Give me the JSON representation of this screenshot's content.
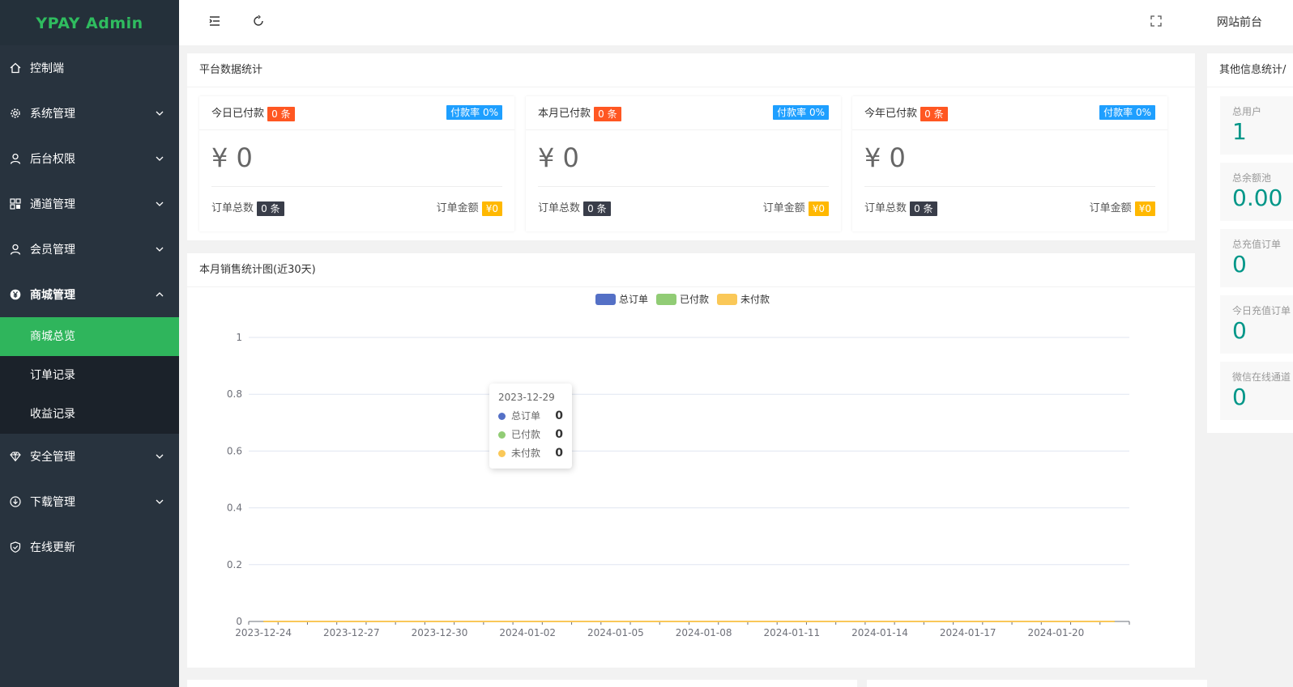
{
  "app": {
    "logo": "YPAY Admin"
  },
  "sidebar": {
    "items": [
      {
        "label": "控制端",
        "icon": "home-icon"
      },
      {
        "label": "系统管理",
        "icon": "gear-icon"
      },
      {
        "label": "后台权限",
        "icon": "user-icon"
      },
      {
        "label": "通道管理",
        "icon": "apps-icon"
      },
      {
        "label": "会员管理",
        "icon": "user-icon"
      },
      {
        "label": "商城管理",
        "icon": "rmb-icon"
      },
      {
        "label": "安全管理",
        "icon": "diamond-icon"
      },
      {
        "label": "下载管理",
        "icon": "download-icon"
      },
      {
        "label": "在线更新",
        "icon": "shield-icon"
      }
    ],
    "sub_items": [
      {
        "label": "商城总览"
      },
      {
        "label": "订单记录"
      },
      {
        "label": "收益记录"
      }
    ]
  },
  "header": {
    "site_link": "网站前台"
  },
  "platform": {
    "title": "平台数据统计",
    "cards": [
      {
        "head": "今日已付款",
        "count_badge": "0 条",
        "rate_badge": "付款率 0%",
        "amount": "¥ 0",
        "orders_label": "订单总数",
        "orders_badge": "0 条",
        "amount_label": "订单金额",
        "amount_badge": "¥0"
      },
      {
        "head": "本月已付款",
        "count_badge": "0 条",
        "rate_badge": "付款率 0%",
        "amount": "¥ 0",
        "orders_label": "订单总数",
        "orders_badge": "0 条",
        "amount_label": "订单金额",
        "amount_badge": "¥0"
      },
      {
        "head": "今年已付款",
        "count_badge": "0 条",
        "rate_badge": "付款率 0%",
        "amount": "¥ 0",
        "orders_label": "订单总数",
        "orders_badge": "0 条",
        "amount_label": "订单金额",
        "amount_badge": "¥0"
      }
    ]
  },
  "other": {
    "title": "其他信息统计/",
    "blocks": [
      {
        "label": "总用户",
        "value": "1"
      },
      {
        "label": "总余额池",
        "value": "0.00"
      },
      {
        "label": "总充值订单",
        "value": "0"
      },
      {
        "label": "今日充值订单",
        "value": "0"
      },
      {
        "label": "微信在线通道",
        "value": "0"
      }
    ]
  },
  "chart_card": {
    "title": "本月销售统计图(近30天)"
  },
  "chart_data": {
    "type": "line",
    "title": "本月销售统计图(近30天)",
    "x": [
      "2023-12-24",
      "2023-12-25",
      "2023-12-26",
      "2023-12-27",
      "2023-12-28",
      "2023-12-29",
      "2023-12-30",
      "2023-12-31",
      "2024-01-01",
      "2024-01-02",
      "2024-01-03",
      "2024-01-04",
      "2024-01-05",
      "2024-01-06",
      "2024-01-07",
      "2024-01-08",
      "2024-01-09",
      "2024-01-10",
      "2024-01-11",
      "2024-01-12",
      "2024-01-13",
      "2024-01-14",
      "2024-01-15",
      "2024-01-16",
      "2024-01-17",
      "2024-01-18",
      "2024-01-19",
      "2024-01-20",
      "2024-01-21",
      "2024-01-22"
    ],
    "x_tick_labels": [
      "2023-12-24",
      "2023-12-27",
      "2023-12-30",
      "2024-01-02",
      "2024-01-05",
      "2024-01-08",
      "2024-01-11",
      "2024-01-14",
      "2024-01-17",
      "2024-01-20"
    ],
    "series": [
      {
        "name": "总订单",
        "color": "#5470c6",
        "values": [
          0,
          0,
          0,
          0,
          0,
          0,
          0,
          0,
          0,
          0,
          0,
          0,
          0,
          0,
          0,
          0,
          0,
          0,
          0,
          0,
          0,
          0,
          0,
          0,
          0,
          0,
          0,
          0,
          0,
          0
        ]
      },
      {
        "name": "已付款",
        "color": "#91cc75",
        "values": [
          0,
          0,
          0,
          0,
          0,
          0,
          0,
          0,
          0,
          0,
          0,
          0,
          0,
          0,
          0,
          0,
          0,
          0,
          0,
          0,
          0,
          0,
          0,
          0,
          0,
          0,
          0,
          0,
          0,
          0
        ]
      },
      {
        "name": "未付款",
        "color": "#fac858",
        "values": [
          0,
          0,
          0,
          0,
          0,
          0,
          0,
          0,
          0,
          0,
          0,
          0,
          0,
          0,
          0,
          0,
          0,
          0,
          0,
          0,
          0,
          0,
          0,
          0,
          0,
          0,
          0,
          0,
          0,
          0
        ]
      }
    ],
    "ylim": [
      0,
      1
    ],
    "y_ticks": [
      "0",
      "0.2",
      "0.4",
      "0.6",
      "0.8",
      "1"
    ],
    "grid": true,
    "legend": "top-center",
    "tooltip": {
      "date": "2023-12-29",
      "rows": [
        {
          "name": "总订单",
          "value": "0",
          "color": "#5470c6"
        },
        {
          "name": "已付款",
          "value": "0",
          "color": "#91cc75"
        },
        {
          "name": "未付款",
          "value": "0",
          "color": "#fac858"
        }
      ]
    }
  }
}
